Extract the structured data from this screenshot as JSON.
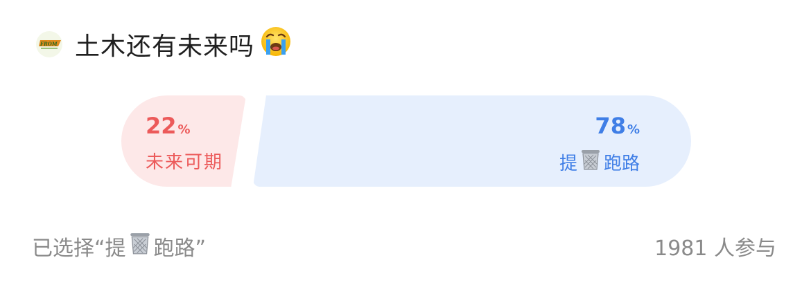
{
  "poll": {
    "avatar_text": "FROM",
    "title": "土木还有未来吗",
    "title_emoji": "crying-face",
    "options": [
      {
        "percent": "22",
        "unit": "%",
        "label": "未来可期",
        "color": "#ec5a5a",
        "background": "#fde8e8",
        "share": 0.22
      },
      {
        "percent": "78",
        "unit": "%",
        "label_before": "提",
        "label_icon": "wastebasket-icon",
        "label_after": "跑路",
        "color": "#3f7ee6",
        "background": "#e6effd",
        "share": 0.78
      }
    ],
    "selection": {
      "prefix": "已选择“提",
      "icon": "wastebasket-icon",
      "suffix": "跑路”"
    },
    "participants": "1981 人参与"
  }
}
